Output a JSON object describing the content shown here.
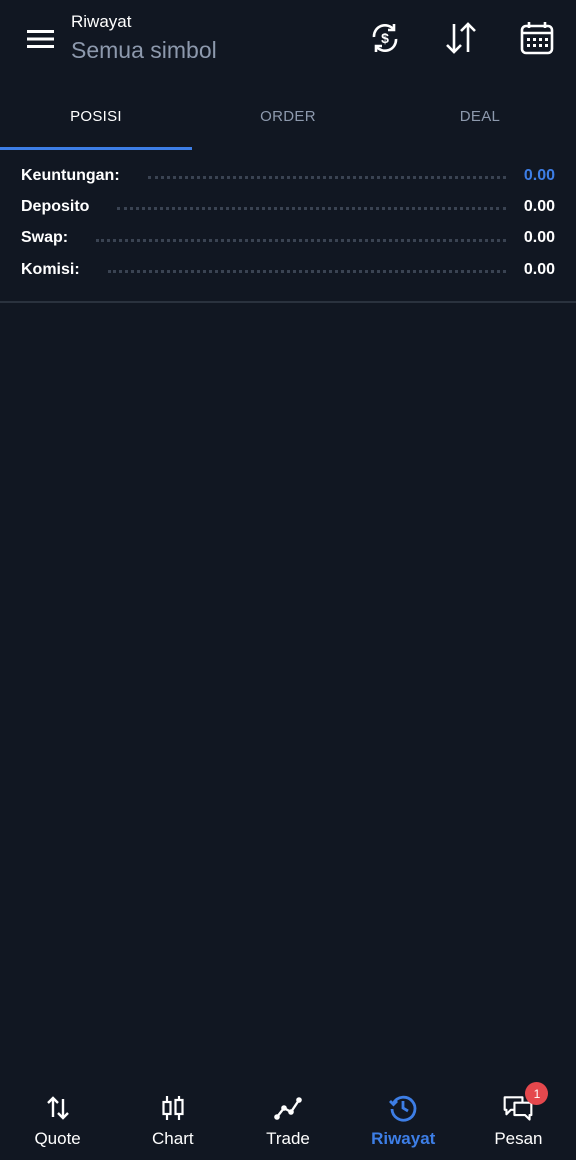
{
  "header": {
    "title": "Riwayat",
    "subtitle": "Semua simbol",
    "icons": [
      "menu-icon",
      "currency-exchange-icon",
      "sort-icon",
      "calendar-icon"
    ]
  },
  "tabs": [
    {
      "label": "POSISI",
      "active": true
    },
    {
      "label": "ORDER",
      "active": false
    },
    {
      "label": "DEAL",
      "active": false
    }
  ],
  "summary": [
    {
      "label": "Keuntungan:",
      "value": "0.00"
    },
    {
      "label": "Deposito",
      "value": "0.00"
    },
    {
      "label": "Swap:",
      "value": "0.00"
    },
    {
      "label": "Komisi:",
      "value": "0.00"
    }
  ],
  "bottom_nav": [
    {
      "label": "Quote",
      "icon": "arrows-up-down-icon",
      "active": false
    },
    {
      "label": "Chart",
      "icon": "candlestick-icon",
      "active": false
    },
    {
      "label": "Trade",
      "icon": "trend-line-icon",
      "active": false
    },
    {
      "label": "Riwayat",
      "icon": "history-icon",
      "active": true
    },
    {
      "label": "Pesan",
      "icon": "chat-icon",
      "active": false,
      "badge": "1"
    }
  ],
  "colors": {
    "background": "#111722",
    "accent": "#3d7ee6",
    "muted": "#8d99ad",
    "badge": "#e5484d"
  }
}
